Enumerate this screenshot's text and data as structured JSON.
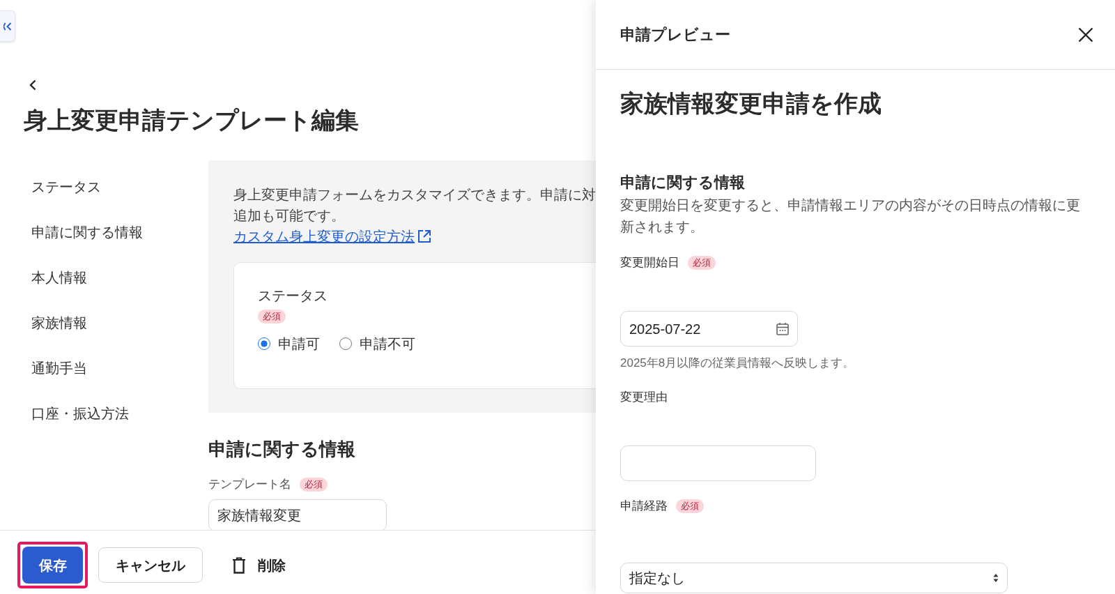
{
  "page": {
    "title": "身上変更申請テンプレート編集"
  },
  "sidebar": {
    "items": [
      {
        "label": "ステータス"
      },
      {
        "label": "申請に関する情報"
      },
      {
        "label": "本人情報"
      },
      {
        "label": "家族情報"
      },
      {
        "label": "通勤手当"
      },
      {
        "label": "口座・振込方法"
      }
    ]
  },
  "intro": {
    "lines": [
      "身上変更申請フォームをカスタマイズできます。申請に対",
      "追加も可能です。"
    ],
    "link": "カスタム身上変更の設定方法"
  },
  "status_card": {
    "label": "ステータス",
    "badge": "必須",
    "options": [
      {
        "label": "申請可",
        "selected": true
      },
      {
        "label": "申請不可",
        "selected": false
      }
    ]
  },
  "section": {
    "title": "申請に関する情報",
    "fields": [
      {
        "label": "テンプレート名",
        "badge": "必須",
        "value": "家族情報変更"
      }
    ]
  },
  "footer": {
    "buttons": [
      {
        "kind": "primary",
        "label": "保存",
        "highlighted": true
      },
      {
        "kind": "secondary",
        "label": "キャンセル",
        "highlighted": false
      },
      {
        "kind": "delete",
        "label": "削除",
        "highlighted": false
      }
    ]
  },
  "preview": {
    "header": "申請プレビュー",
    "title": "家族情報変更申請を作成",
    "section_title": "申請に関する情報",
    "description": "変更開始日を変更すると、申請情報エリアの内容がその日時点の情報に更新されます。",
    "fields": [
      {
        "kind": "date",
        "label": "変更開始日",
        "badge": "必須",
        "value": "2025-07-22",
        "help": "2025年8月以降の従業員情報へ反映します。"
      },
      {
        "kind": "text",
        "label": "変更理由"
      },
      {
        "kind": "select",
        "label": "申請経路",
        "badge": "必須",
        "value": "指定なし"
      }
    ]
  }
}
